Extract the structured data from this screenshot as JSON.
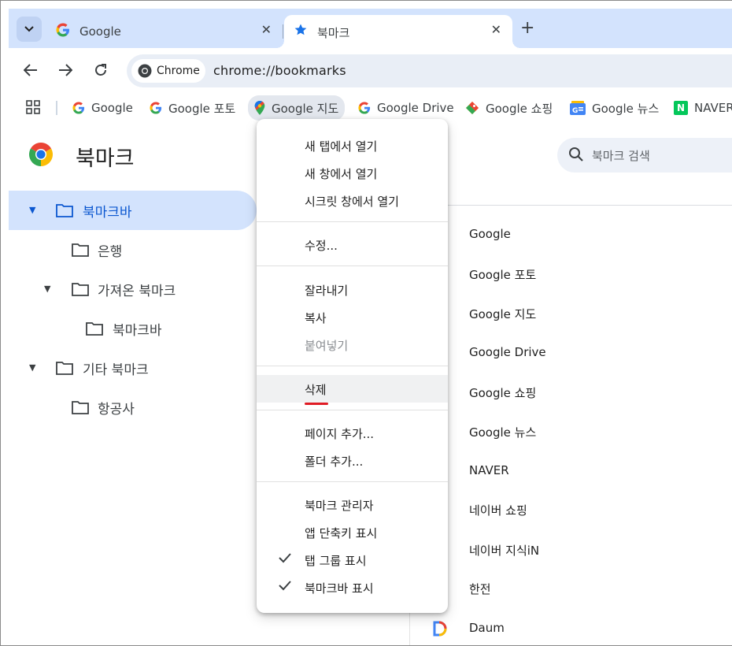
{
  "tabs": [
    {
      "title": "Google",
      "icon": "google-g-icon",
      "close": "✕"
    },
    {
      "title": "북마크",
      "icon": "star-icon",
      "close": "✕"
    }
  ],
  "toolbar": {
    "chip_label": "Chrome",
    "url": "chrome://bookmarks"
  },
  "bookmarks_bar": [
    {
      "label": "Google",
      "icon": "google-g-icon"
    },
    {
      "label": "Google 포토",
      "icon": "google-g-icon"
    },
    {
      "label": "Google 지도",
      "icon": "maps-pin-icon"
    },
    {
      "label": "Google Drive",
      "icon": "google-g-icon"
    },
    {
      "label": "Google 쇼핑",
      "icon": "shopping-tag-icon"
    },
    {
      "label": "Google 뉴스",
      "icon": "news-icon"
    },
    {
      "label": "NAVER",
      "icon": "naver-icon"
    }
  ],
  "page": {
    "title": "북마크",
    "search_placeholder": "북마크 검색"
  },
  "tree": [
    {
      "label": "북마크바",
      "selected": true,
      "expanded": true
    },
    {
      "label": "은행"
    },
    {
      "label": "가져온 북마크",
      "expanded": true
    },
    {
      "label": "북마크바"
    },
    {
      "label": "기타 북마크",
      "expanded": true
    },
    {
      "label": "항공사"
    }
  ],
  "list": [
    "Google",
    "Google 포토",
    "Google 지도",
    "Google Drive",
    "Google 쇼핑",
    "Google 뉴스",
    "NAVER",
    "네이버 쇼핑",
    "네이버 지식iN",
    "한전",
    "Daum"
  ],
  "menu": {
    "open_new_tab": "새 탭에서 열기",
    "open_new_window": "새 창에서 열기",
    "open_incognito": "시크릿 창에서 열기",
    "edit": "수정...",
    "cut": "잘라내기",
    "copy": "복사",
    "paste": "붙여넣기",
    "delete": "삭제",
    "add_page": "페이지 추가...",
    "add_folder": "폴더 추가...",
    "bookmark_manager": "북마크 관리자",
    "show_apps_shortcut": "앱 단축키 표시",
    "show_tab_groups": "탭 그룹 표시",
    "show_bookmarks_bar": "북마크바 표시"
  },
  "colors": {
    "accent": "#0b57d0",
    "tabstrip": "#d3e3fd",
    "highlight_red": "#e01b24"
  }
}
